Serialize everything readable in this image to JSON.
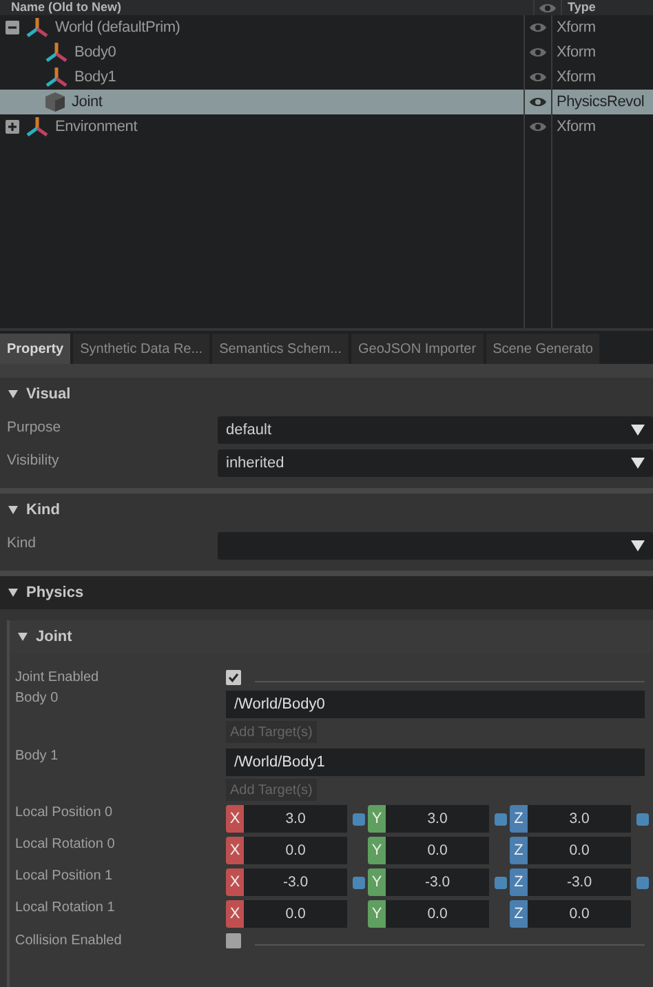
{
  "stage": {
    "columns": {
      "name": "Name (Old to New)",
      "type": "Type"
    },
    "items": [
      {
        "label": "World (defaultPrim)",
        "kind": "xform",
        "type": "Xform",
        "selected": false,
        "expanded": true,
        "children": [
          {
            "label": "Body0",
            "kind": "xform",
            "type": "Xform",
            "selected": false
          },
          {
            "label": "Body1",
            "kind": "xform",
            "type": "Xform",
            "selected": false
          },
          {
            "label": "Joint",
            "kind": "joint",
            "type": "PhysicsRevol",
            "selected": true
          }
        ]
      },
      {
        "label": "Environment",
        "kind": "xform",
        "type": "Xform",
        "selected": false,
        "expanded": false
      }
    ]
  },
  "tabs": [
    {
      "label": "Property",
      "selected": true
    },
    {
      "label": "Synthetic Data Re...",
      "selected": false
    },
    {
      "label": "Semantics Schem...",
      "selected": false
    },
    {
      "label": "GeoJSON Importer",
      "selected": false
    },
    {
      "label": "Scene Generato",
      "selected": false
    }
  ],
  "visual": {
    "title": "Visual",
    "rows": [
      {
        "label": "Purpose",
        "value": "default"
      },
      {
        "label": "Visibility",
        "value": "inherited"
      }
    ]
  },
  "kind": {
    "title": "Kind",
    "rows": [
      {
        "label": "Kind"
      }
    ]
  },
  "physics": {
    "title": "Physics",
    "joint": {
      "title": "Joint",
      "rows": [
        {
          "kind": "checkbox",
          "label": "Joint Enabled",
          "checked": true
        },
        {
          "kind": "target",
          "label": "Body 0",
          "value": "/World/Body0",
          "button": "Add Target(s)"
        },
        {
          "kind": "target",
          "label": "Body 1",
          "value": "/World/Body1",
          "button": "Add Target(s)"
        },
        {
          "kind": "vector",
          "label": "Local Position 0",
          "linked": true,
          "axes": [
            {
              "axis": "X",
              "value": "3.0"
            },
            {
              "axis": "Y",
              "value": "3.0"
            },
            {
              "axis": "Z",
              "value": "3.0"
            }
          ]
        },
        {
          "kind": "vector",
          "label": "Local Rotation 0",
          "linked": false,
          "axes": [
            {
              "axis": "X",
              "value": "0.0"
            },
            {
              "axis": "Y",
              "value": "0.0"
            },
            {
              "axis": "Z",
              "value": "0.0"
            }
          ]
        },
        {
          "kind": "vector",
          "label": "Local Position 1",
          "linked": true,
          "axes": [
            {
              "axis": "X",
              "value": "-3.0"
            },
            {
              "axis": "Y",
              "value": "-3.0"
            },
            {
              "axis": "Z",
              "value": "-3.0"
            }
          ]
        },
        {
          "kind": "vector",
          "label": "Local Rotation 1",
          "linked": false,
          "axes": [
            {
              "axis": "X",
              "value": "0.0"
            },
            {
              "axis": "Y",
              "value": "0.0"
            },
            {
              "axis": "Z",
              "value": "0.0"
            }
          ]
        },
        {
          "kind": "checkbox",
          "label": "Collision Enabled",
          "checked": false
        }
      ]
    }
  }
}
